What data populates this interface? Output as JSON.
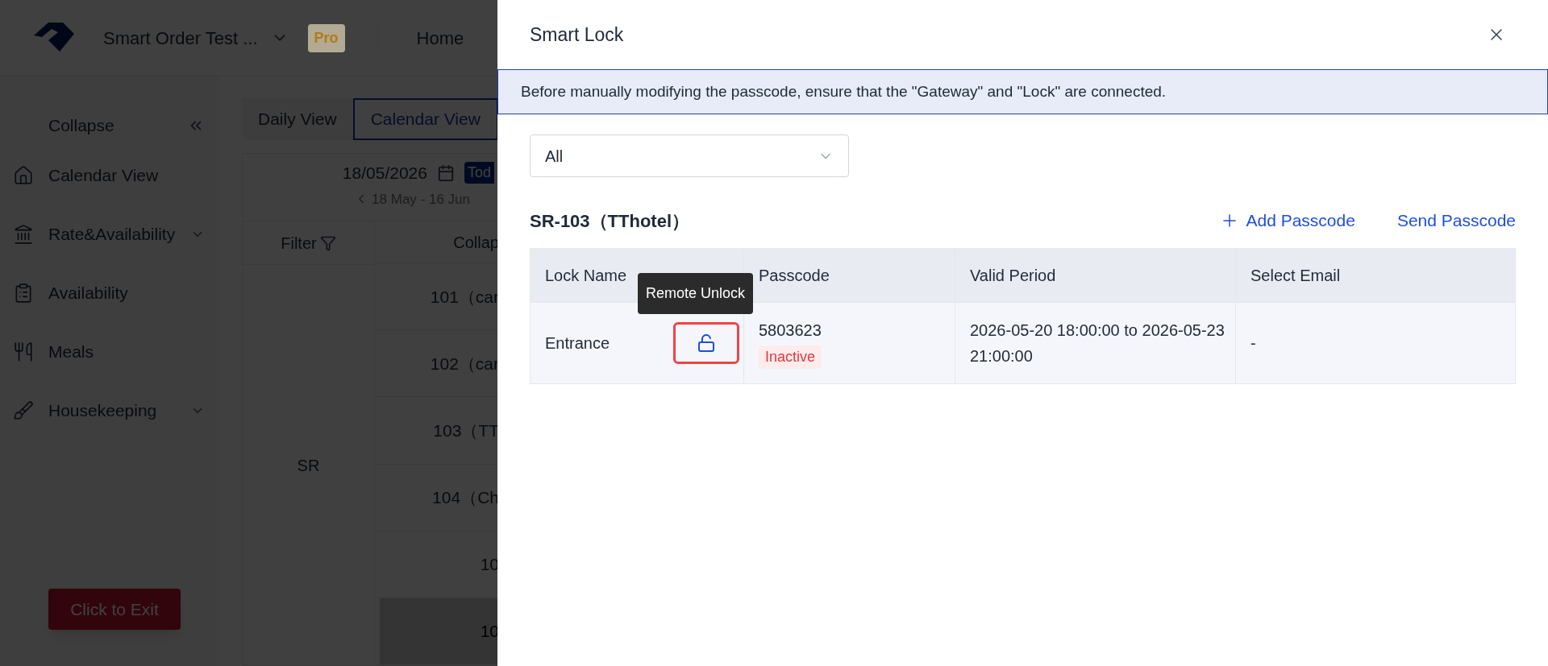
{
  "app": {
    "brand": "Smart Order Test ...",
    "plan": "Pro",
    "nav": [
      {
        "label": "Home",
        "selected": false
      }
    ]
  },
  "sidebar": {
    "collapse": "Collapse",
    "items": [
      {
        "label": "Calendar View",
        "expandable": false
      },
      {
        "label": "Rate&Availability",
        "expandable": true
      },
      {
        "label": "Availability",
        "expandable": false
      },
      {
        "label": "Meals",
        "expandable": false
      },
      {
        "label": "Housekeeping",
        "expandable": true
      }
    ],
    "exit_button": "Click to Exit"
  },
  "view_tabs": [
    {
      "label": "Daily View",
      "selected": false
    },
    {
      "label": "Calendar View",
      "selected": true
    }
  ],
  "calendar": {
    "date": "18/05/2026",
    "today": "Tod",
    "range": "18 May - 16 Jun",
    "filter": "Filter",
    "column": "Collap",
    "group": "SR",
    "rooms": [
      {
        "label": "101（car",
        "selected": false
      },
      {
        "label": "102（car",
        "selected": false
      },
      {
        "label": "103（TT",
        "selected": false
      },
      {
        "label": "104（Ch",
        "selected": false
      },
      {
        "label": "10",
        "selected": false
      },
      {
        "label": "10",
        "selected": true
      }
    ]
  },
  "drawer": {
    "title": "Smart Lock",
    "notice": "Before manually modifying the passcode, ensure that the \"Gateway\" and \"Lock\" are connected.",
    "select": {
      "value": "All"
    },
    "room_title": "SR-103（TThotel）",
    "actions": [
      {
        "label": "Add Passcode",
        "kind": "add"
      },
      {
        "label": "Send Passcode",
        "kind": "plain"
      }
    ],
    "table": {
      "columns": [
        "Lock Name",
        "Passcode",
        "Valid Period",
        "Select Email"
      ],
      "rows": [
        {
          "lock_name": "Entrance",
          "passcode": "5803623",
          "status": "Inactive",
          "valid_period": "2026-05-20 18:00:00 to 2026-05-23 21:00:00",
          "email": "-"
        }
      ]
    },
    "tooltip": "Remote Unlock"
  }
}
